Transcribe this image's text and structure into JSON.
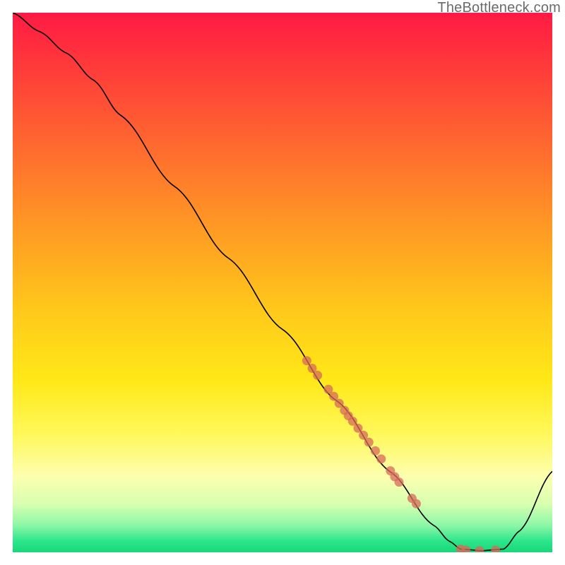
{
  "watermark": "TheBottleneck.com",
  "chart_data": {
    "type": "line",
    "title": "",
    "xlabel": "",
    "ylabel": "",
    "xlim": [
      0,
      1
    ],
    "ylim": [
      0,
      1
    ],
    "axes_hidden": true,
    "grid": false,
    "background": {
      "type": "vertical-gradient",
      "stops": [
        {
          "pos": 0.0,
          "color": "#ff1a44"
        },
        {
          "pos": 0.1,
          "color": "#ff3a3a"
        },
        {
          "pos": 0.25,
          "color": "#ff6a2f"
        },
        {
          "pos": 0.4,
          "color": "#ff9a24"
        },
        {
          "pos": 0.55,
          "color": "#ffc81a"
        },
        {
          "pos": 0.68,
          "color": "#ffe817"
        },
        {
          "pos": 0.78,
          "color": "#fff85a"
        },
        {
          "pos": 0.86,
          "color": "#fdffb0"
        },
        {
          "pos": 0.91,
          "color": "#d8ffb0"
        },
        {
          "pos": 0.95,
          "color": "#8cf7a8"
        },
        {
          "pos": 0.98,
          "color": "#2be58a"
        },
        {
          "pos": 1.0,
          "color": "#18d878"
        }
      ]
    },
    "series": [
      {
        "name": "curve",
        "kind": "path",
        "points": [
          {
            "x": 0.0,
            "y": 1.0
          },
          {
            "x": 0.05,
            "y": 0.965
          },
          {
            "x": 0.1,
            "y": 0.925
          },
          {
            "x": 0.15,
            "y": 0.875
          },
          {
            "x": 0.2,
            "y": 0.81
          },
          {
            "x": 0.3,
            "y": 0.678
          },
          {
            "x": 0.4,
            "y": 0.545
          },
          {
            "x": 0.5,
            "y": 0.413
          },
          {
            "x": 0.6,
            "y": 0.281
          },
          {
            "x": 0.7,
            "y": 0.149
          },
          {
            "x": 0.78,
            "y": 0.05
          },
          {
            "x": 0.81,
            "y": 0.02
          },
          {
            "x": 0.83,
            "y": 0.006
          },
          {
            "x": 0.87,
            "y": 0.003
          },
          {
            "x": 0.91,
            "y": 0.006
          },
          {
            "x": 0.94,
            "y": 0.04
          },
          {
            "x": 1.0,
            "y": 0.15
          }
        ]
      },
      {
        "name": "dots",
        "kind": "scatter",
        "color": "#d76a5a",
        "opacity": 0.75,
        "radius_px": 6.5,
        "points": [
          {
            "x": 0.545,
            "y": 0.355
          },
          {
            "x": 0.555,
            "y": 0.341
          },
          {
            "x": 0.565,
            "y": 0.328
          },
          {
            "x": 0.585,
            "y": 0.302
          },
          {
            "x": 0.595,
            "y": 0.289
          },
          {
            "x": 0.605,
            "y": 0.276
          },
          {
            "x": 0.615,
            "y": 0.263
          },
          {
            "x": 0.622,
            "y": 0.253
          },
          {
            "x": 0.63,
            "y": 0.243
          },
          {
            "x": 0.64,
            "y": 0.23
          },
          {
            "x": 0.65,
            "y": 0.217
          },
          {
            "x": 0.66,
            "y": 0.204
          },
          {
            "x": 0.672,
            "y": 0.188
          },
          {
            "x": 0.683,
            "y": 0.173
          },
          {
            "x": 0.7,
            "y": 0.151
          },
          {
            "x": 0.708,
            "y": 0.14
          },
          {
            "x": 0.716,
            "y": 0.13
          },
          {
            "x": 0.74,
            "y": 0.1
          },
          {
            "x": 0.748,
            "y": 0.09
          },
          {
            "x": 0.83,
            "y": 0.006
          },
          {
            "x": 0.84,
            "y": 0.004
          },
          {
            "x": 0.865,
            "y": 0.003
          },
          {
            "x": 0.895,
            "y": 0.004
          }
        ]
      }
    ]
  }
}
